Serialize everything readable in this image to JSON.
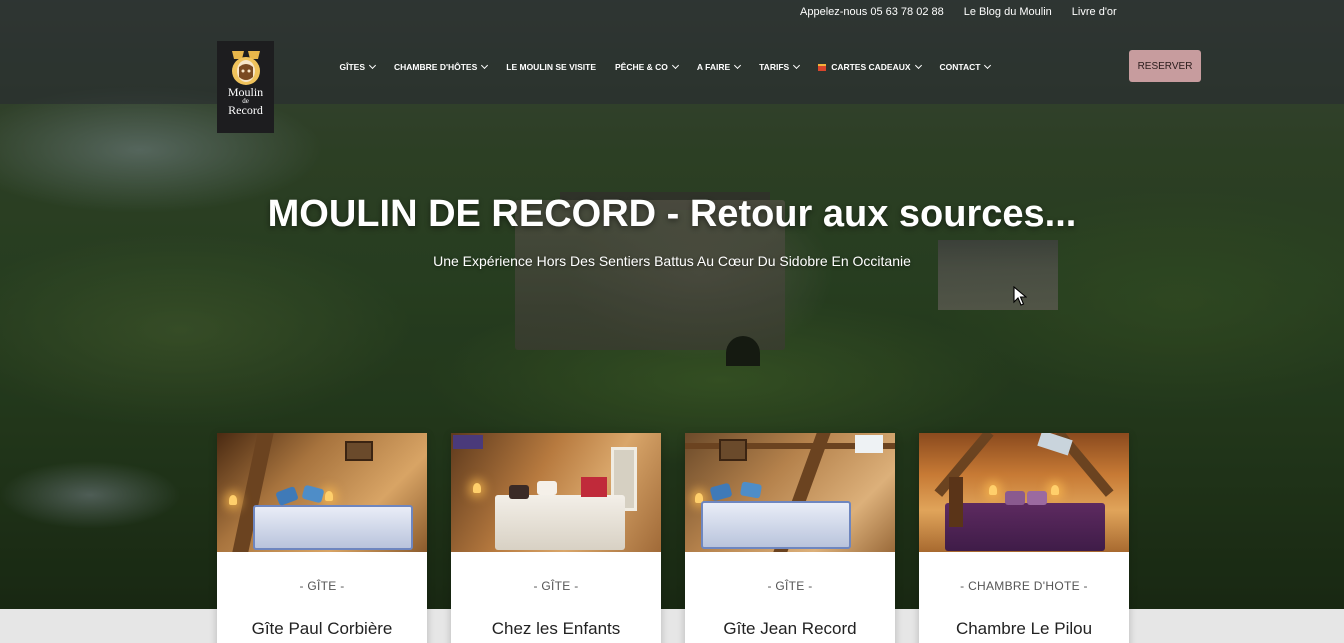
{
  "utility_links": [
    {
      "label": "Appelez-nous 05 63 78 02 88"
    },
    {
      "label": "Le Blog du Moulin"
    },
    {
      "label": "Livre d'or"
    }
  ],
  "logo": {
    "line1": "Moulin",
    "line2": "de",
    "line3": "Record"
  },
  "nav": [
    {
      "label": "GÎTES",
      "dropdown": true
    },
    {
      "label": "CHAMBRE D'HÔTES",
      "dropdown": true
    },
    {
      "label": "LE MOULIN SE VISITE",
      "dropdown": false
    },
    {
      "label": "PÊCHE & CO",
      "dropdown": true
    },
    {
      "label": "A FAIRE",
      "dropdown": true
    },
    {
      "label": "TARIFS",
      "dropdown": true
    },
    {
      "label": "CARTES CADEAUX",
      "dropdown": true,
      "icon": "gift-icon"
    },
    {
      "label": "CONTACT",
      "dropdown": true
    }
  ],
  "reserve_label": "RESERVER",
  "hero": {
    "title": "MOULIN DE RECORD - Retour aux sources...",
    "subtitle": "Une Expérience Hors Des Sentiers Battus Au Cœur Du Sidobre En Occitanie"
  },
  "cards": [
    {
      "type": "- GÎTE -",
      "name": "Gîte Paul Corbière"
    },
    {
      "type": "- GÎTE -",
      "name": "Chez les Enfants"
    },
    {
      "type": "- GÎTE -",
      "name": "Gîte Jean Record"
    },
    {
      "type": "- CHAMBRE D'HOTE -",
      "name": "Chambre Le Pilou"
    }
  ],
  "colors": {
    "reserve_bg": "#c79c9e",
    "logo_bg": "#1d1d1f",
    "top_strip": "rgba(40,44,48,0.62)"
  }
}
